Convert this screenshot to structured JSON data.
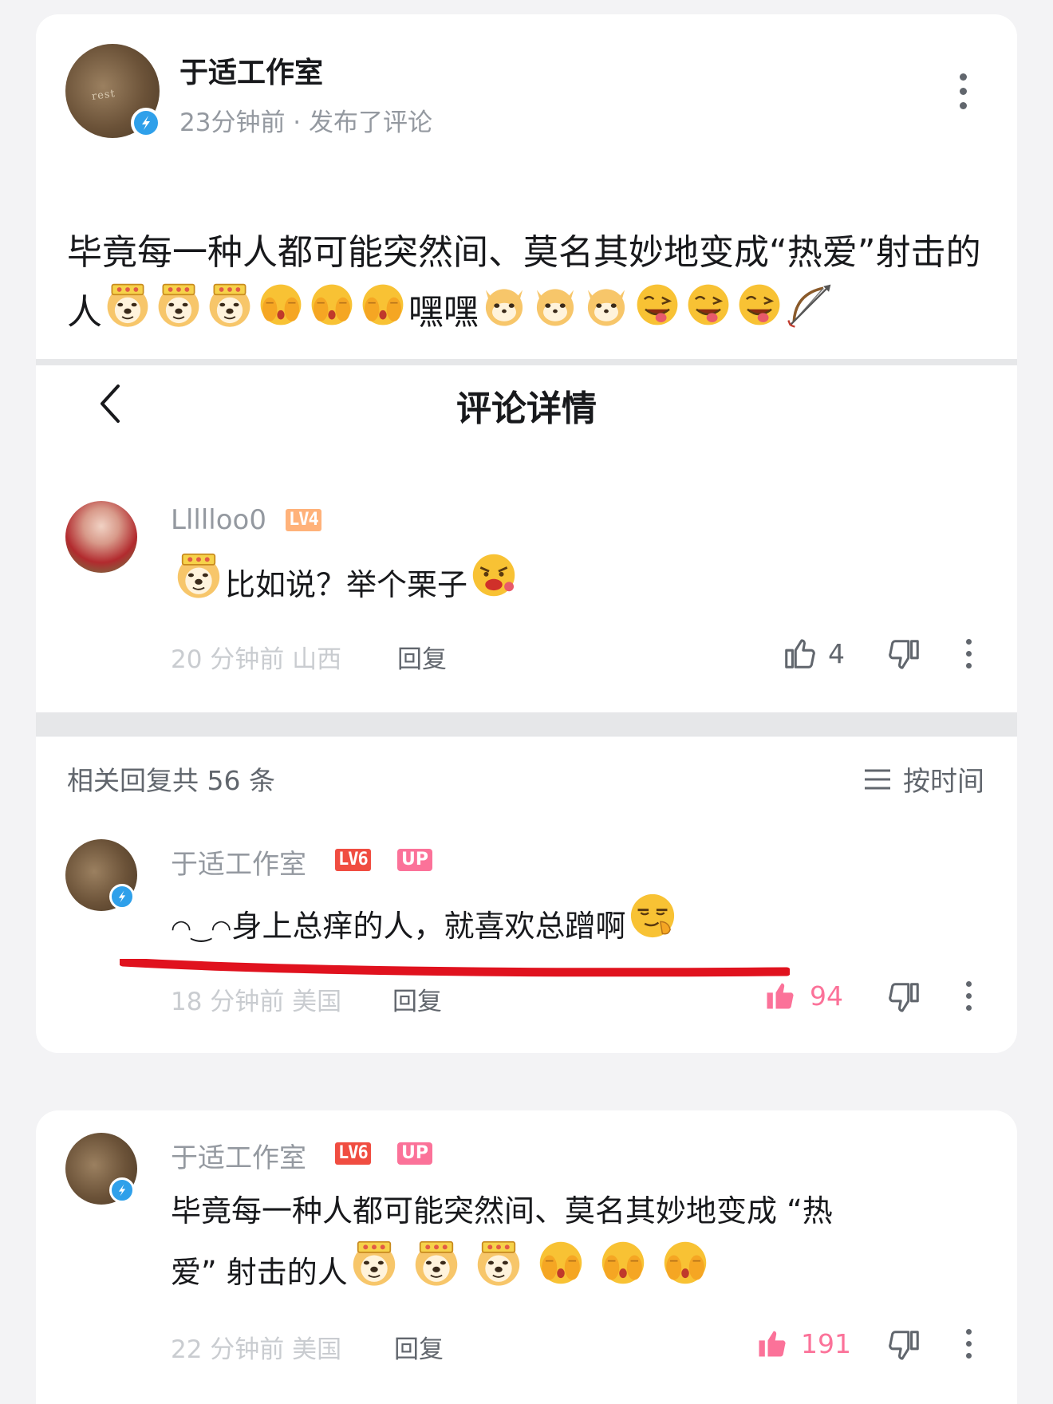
{
  "post": {
    "author": "于适工作室",
    "meta": "23分钟前 · 发布了评论",
    "text_part1": "毕竟每一种人都可能突然间、莫名其妙地变成“热爱”射击的人",
    "text_part2": "嘿嘿",
    "avatar_text": "rest"
  },
  "detail": {
    "title": "评论详情",
    "comment": {
      "user": "Llllloo0",
      "level": "LV4",
      "text": "比如说？举个栗子",
      "time": "20 分钟前 山西",
      "reply": "回复",
      "likes": "4"
    }
  },
  "replies": {
    "header": "相关回复共 56 条",
    "sort": "按时间",
    "items": [
      {
        "user": "于适工作室",
        "level": "LV6",
        "badge": "UP",
        "prefix": "◠‿◠",
        "text": "身上总痒的人，就喜欢总蹭啊",
        "time": "18 分钟前 美国",
        "reply": "回复",
        "likes": "94"
      },
      {
        "user": "于适工作室",
        "level": "LV6",
        "badge": "UP",
        "text_line1": "毕竟每一种人都可能突然间、莫名其妙地变成 “热",
        "text_line2": "爱” 射击的人",
        "time": "22 分钟前 美国",
        "reply": "回复",
        "likes": "191"
      }
    ]
  },
  "colors": {
    "accent_pink": "#fb7299",
    "verified_blue": "#2fa0ea",
    "underline_red": "#e0121e"
  },
  "icons": [
    "more-icon",
    "back-icon",
    "thumb-up-icon",
    "thumb-down-icon",
    "sort-icon",
    "verified-icon",
    "emoji-doge",
    "emoji-cover-face",
    "emoji-cat",
    "emoji-tongue",
    "emoji-bow-arrow"
  ]
}
